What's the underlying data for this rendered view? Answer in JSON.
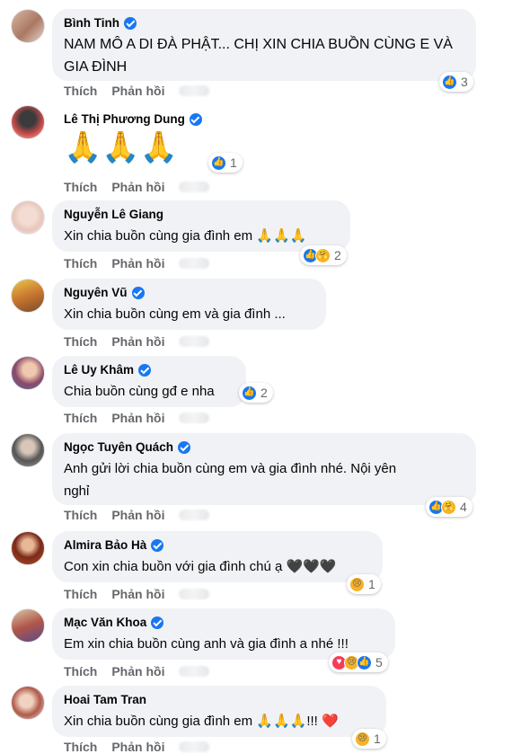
{
  "actions": {
    "like": "Thích",
    "reply": "Phản hồi"
  },
  "comments": [
    {
      "name": "Bình Tinh",
      "verified": true,
      "text": [
        "NAM MÔ A DI ĐÀ PHẬT... CHỊ XIN CHIA BUỒN CÙNG E VÀ",
        "GIA ĐÌNH"
      ],
      "reactions": [
        "like"
      ],
      "count": "3"
    },
    {
      "name": "Lê Thị Phương Dung",
      "verified": true,
      "text": [
        "🙏🙏🙏"
      ],
      "reactions": [
        "like"
      ],
      "count": "1"
    },
    {
      "name": "Nguyễn Lê Giang",
      "verified": false,
      "text": [
        "Xin chia buồn cùng gia đình em 🙏🙏🙏"
      ],
      "reactions": [
        "like",
        "care"
      ],
      "count": "2"
    },
    {
      "name": "Nguyên Vũ",
      "verified": true,
      "text": [
        "Xin chia buồn cùng em và gia đình ..."
      ],
      "reactions": [],
      "count": ""
    },
    {
      "name": "Lê Uy Khâm",
      "verified": true,
      "text": [
        "Chia buồn cùng gđ e nha"
      ],
      "reactions": [
        "like"
      ],
      "count": "2"
    },
    {
      "name": "Ngọc Tuyên Quách",
      "verified": true,
      "text": [
        "Anh gửi lời chia buồn cùng em và gia đình nhé. Nội yên",
        "nghỉ"
      ],
      "reactions": [
        "like",
        "care"
      ],
      "count": "4"
    },
    {
      "name": "Almira Bảo Hà",
      "verified": true,
      "text": [
        "Con xin chia buồn với gia đình chú ạ 🖤🖤🖤"
      ],
      "reactions": [
        "sad"
      ],
      "count": "1"
    },
    {
      "name": "Mạc Văn Khoa",
      "verified": true,
      "text": [
        "Em xin chia buồn cùng anh và gia đình a nhé !!!"
      ],
      "reactions": [
        "love",
        "sad",
        "like"
      ],
      "count": "5"
    },
    {
      "name": "Hoai Tam Tran",
      "verified": false,
      "text": [
        "Xin chia buồn cùng gia đình em 🙏🙏🙏!!! ❤️"
      ],
      "reactions": [
        "sad"
      ],
      "count": "1"
    }
  ],
  "colors": {
    "bubble": "#f0f2f5",
    "like": "#1877f2",
    "meta": "#65676b",
    "text": "#050505"
  }
}
